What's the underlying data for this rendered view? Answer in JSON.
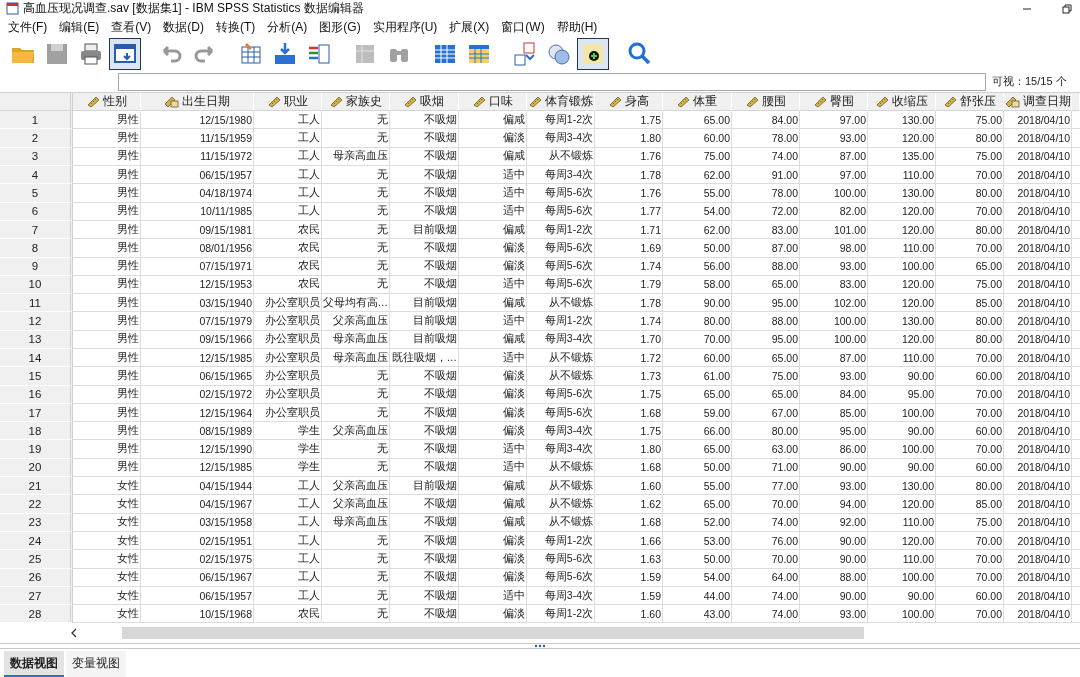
{
  "window": {
    "title": "高血压现况调查.sav [数据集1] - IBM SPSS Statistics 数据编辑器"
  },
  "menu": [
    "文件(F)",
    "编辑(E)",
    "查看(V)",
    "数据(D)",
    "转换(T)",
    "分析(A)",
    "图形(G)",
    "实用程序(U)",
    "扩展(X)",
    "窗口(W)",
    "帮助(H)"
  ],
  "toolbar": [
    {
      "disabled": false,
      "selected": false
    },
    {
      "disabled": true,
      "selected": false
    },
    {
      "disabled": false,
      "selected": false
    },
    {
      "disabled": false,
      "selected": true
    },
    {
      "disabled": true,
      "selected": false
    },
    {
      "disabled": true,
      "selected": false
    },
    {
      "disabled": false,
      "selected": false
    },
    {
      "disabled": false,
      "selected": false
    },
    {
      "disabled": false,
      "selected": false
    },
    {
      "disabled": true,
      "selected": false
    },
    {
      "disabled": true,
      "selected": false
    },
    {
      "disabled": false,
      "selected": false
    },
    {
      "disabled": false,
      "selected": false
    },
    {
      "disabled": false,
      "selected": false
    },
    {
      "disabled": false,
      "selected": false
    },
    {
      "disabled": false,
      "selected": true
    },
    {
      "disabled": false,
      "selected": false
    }
  ],
  "visible_count": "可视：15/15 个",
  "table": {
    "columns": [
      {
        "label": "性别",
        "kind": "scale"
      },
      {
        "label": "出生日期",
        "kind": "date"
      },
      {
        "label": "职业",
        "kind": "scale"
      },
      {
        "label": "家族史",
        "kind": "scale"
      },
      {
        "label": "吸烟",
        "kind": "scale"
      },
      {
        "label": "口味",
        "kind": "scale"
      },
      {
        "label": "体育锻炼",
        "kind": "scale"
      },
      {
        "label": "身高",
        "kind": "scale"
      },
      {
        "label": "体重",
        "kind": "scale"
      },
      {
        "label": "腰围",
        "kind": "scale"
      },
      {
        "label": "臀围",
        "kind": "scale"
      },
      {
        "label": "收缩压",
        "kind": "scale"
      },
      {
        "label": "舒张压",
        "kind": "scale"
      },
      {
        "label": "调查日期",
        "kind": "date"
      }
    ],
    "rows": [
      {
        "number": "1",
        "cells": [
          "男性",
          "12/15/1980",
          "工人",
          "无",
          "不吸烟",
          "偏咸",
          "每周1-2次",
          "1.75",
          "65.00",
          "84.00",
          "97.00",
          "130.00",
          "75.00",
          "2018/04/10"
        ]
      },
      {
        "number": "2",
        "cells": [
          "男性",
          "11/15/1959",
          "工人",
          "无",
          "不吸烟",
          "偏淡",
          "每周3-4次",
          "1.80",
          "60.00",
          "78.00",
          "93.00",
          "120.00",
          "80.00",
          "2018/04/10"
        ]
      },
      {
        "number": "3",
        "cells": [
          "男性",
          "11/15/1972",
          "工人",
          "母亲高血压",
          "不吸烟",
          "偏咸",
          "从不锻炼",
          "1.76",
          "75.00",
          "74.00",
          "87.00",
          "135.00",
          "75.00",
          "2018/04/10"
        ]
      },
      {
        "number": "4",
        "cells": [
          "男性",
          "06/15/1957",
          "工人",
          "无",
          "不吸烟",
          "适中",
          "每周3-4次",
          "1.78",
          "62.00",
          "91.00",
          "97.00",
          "110.00",
          "70.00",
          "2018/04/10"
        ]
      },
      {
        "number": "5",
        "cells": [
          "男性",
          "04/18/1974",
          "工人",
          "无",
          "不吸烟",
          "适中",
          "每周5-6次",
          "1.76",
          "55.00",
          "78.00",
          "100.00",
          "130.00",
          "80.00",
          "2018/04/10"
        ]
      },
      {
        "number": "6",
        "cells": [
          "男性",
          "10/11/1985",
          "工人",
          "无",
          "不吸烟",
          "适中",
          "每周5-6次",
          "1.77",
          "54.00",
          "72.00",
          "82.00",
          "120.00",
          "70.00",
          "2018/04/10"
        ]
      },
      {
        "number": "7",
        "cells": [
          "男性",
          "09/15/1981",
          "农民",
          "无",
          "目前吸烟",
          "偏咸",
          "每周1-2次",
          "1.71",
          "62.00",
          "83.00",
          "101.00",
          "120.00",
          "80.00",
          "2018/04/10"
        ]
      },
      {
        "number": "8",
        "cells": [
          "男性",
          "08/01/1956",
          "农民",
          "无",
          "不吸烟",
          "偏淡",
          "每周5-6次",
          "1.69",
          "50.00",
          "87.00",
          "98.00",
          "110.00",
          "70.00",
          "2018/04/10"
        ]
      },
      {
        "number": "9",
        "cells": [
          "男性",
          "07/15/1971",
          "农民",
          "无",
          "不吸烟",
          "偏淡",
          "每周5-6次",
          "1.74",
          "56.00",
          "88.00",
          "93.00",
          "100.00",
          "65.00",
          "2018/04/10"
        ]
      },
      {
        "number": "10",
        "cells": [
          "男性",
          "12/15/1953",
          "农民",
          "无",
          "不吸烟",
          "适中",
          "每周5-6次",
          "1.79",
          "58.00",
          "65.00",
          "83.00",
          "120.00",
          "75.00",
          "2018/04/10"
        ]
      },
      {
        "number": "11",
        "cells": [
          "男性",
          "03/15/1940",
          "办公室职员",
          "父母均有高…",
          "目前吸烟",
          "偏咸",
          "从不锻炼",
          "1.78",
          "90.00",
          "95.00",
          "102.00",
          "120.00",
          "85.00",
          "2018/04/10"
        ]
      },
      {
        "number": "12",
        "cells": [
          "男性",
          "07/15/1979",
          "办公室职员",
          "父亲高血压",
          "目前吸烟",
          "适中",
          "每周1-2次",
          "1.74",
          "80.00",
          "88.00",
          "100.00",
          "130.00",
          "80.00",
          "2018/04/10"
        ]
      },
      {
        "number": "13",
        "cells": [
          "男性",
          "09/15/1966",
          "办公室职员",
          "母亲高血压",
          "目前吸烟",
          "偏咸",
          "每周3-4次",
          "1.70",
          "70.00",
          "95.00",
          "100.00",
          "120.00",
          "80.00",
          "2018/04/10"
        ]
      },
      {
        "number": "14",
        "cells": [
          "男性",
          "12/15/1985",
          "办公室职员",
          "母亲高血压",
          "既往吸烟，…",
          "适中",
          "从不锻炼",
          "1.72",
          "60.00",
          "65.00",
          "87.00",
          "110.00",
          "70.00",
          "2018/04/10"
        ]
      },
      {
        "number": "15",
        "cells": [
          "男性",
          "06/15/1965",
          "办公室职员",
          "无",
          "不吸烟",
          "偏淡",
          "从不锻炼",
          "1.73",
          "61.00",
          "75.00",
          "93.00",
          "90.00",
          "60.00",
          "2018/04/10"
        ]
      },
      {
        "number": "16",
        "cells": [
          "男性",
          "02/15/1972",
          "办公室职员",
          "无",
          "不吸烟",
          "偏淡",
          "每周5-6次",
          "1.75",
          "65.00",
          "65.00",
          "84.00",
          "95.00",
          "70.00",
          "2018/04/10"
        ]
      },
      {
        "number": "17",
        "cells": [
          "男性",
          "12/15/1964",
          "办公室职员",
          "无",
          "不吸烟",
          "偏淡",
          "每周5-6次",
          "1.68",
          "59.00",
          "67.00",
          "85.00",
          "100.00",
          "70.00",
          "2018/04/10"
        ]
      },
      {
        "number": "18",
        "cells": [
          "男性",
          "08/15/1989",
          "学生",
          "父亲高血压",
          "不吸烟",
          "偏淡",
          "每周3-4次",
          "1.75",
          "66.00",
          "80.00",
          "95.00",
          "90.00",
          "60.00",
          "2018/04/10"
        ]
      },
      {
        "number": "19",
        "cells": [
          "男性",
          "12/15/1990",
          "学生",
          "无",
          "不吸烟",
          "适中",
          "每周3-4次",
          "1.80",
          "65.00",
          "63.00",
          "86.00",
          "100.00",
          "70.00",
          "2018/04/10"
        ]
      },
      {
        "number": "20",
        "cells": [
          "男性",
          "12/15/1985",
          "学生",
          "无",
          "不吸烟",
          "适中",
          "从不锻炼",
          "1.68",
          "50.00",
          "71.00",
          "90.00",
          "90.00",
          "60.00",
          "2018/04/10"
        ]
      },
      {
        "number": "21",
        "cells": [
          "女性",
          "04/15/1944",
          "工人",
          "父亲高血压",
          "目前吸烟",
          "偏咸",
          "从不锻炼",
          "1.60",
          "55.00",
          "77.00",
          "93.00",
          "130.00",
          "80.00",
          "2018/04/10"
        ]
      },
      {
        "number": "22",
        "cells": [
          "女性",
          "04/15/1967",
          "工人",
          "父亲高血压",
          "不吸烟",
          "偏咸",
          "从不锻炼",
          "1.62",
          "65.00",
          "70.00",
          "94.00",
          "120.00",
          "85.00",
          "2018/04/10"
        ]
      },
      {
        "number": "23",
        "cells": [
          "女性",
          "03/15/1958",
          "工人",
          "母亲高血压",
          "不吸烟",
          "偏咸",
          "从不锻炼",
          "1.68",
          "52.00",
          "74.00",
          "92.00",
          "110.00",
          "75.00",
          "2018/04/10"
        ]
      },
      {
        "number": "24",
        "cells": [
          "女性",
          "02/15/1951",
          "工人",
          "无",
          "不吸烟",
          "偏淡",
          "每周1-2次",
          "1.66",
          "53.00",
          "76.00",
          "90.00",
          "120.00",
          "70.00",
          "2018/04/10"
        ]
      },
      {
        "number": "25",
        "cells": [
          "女性",
          "02/15/1975",
          "工人",
          "无",
          "不吸烟",
          "偏淡",
          "每周5-6次",
          "1.63",
          "50.00",
          "70.00",
          "90.00",
          "110.00",
          "70.00",
          "2018/04/10"
        ]
      },
      {
        "number": "26",
        "cells": [
          "女性",
          "06/15/1967",
          "工人",
          "无",
          "不吸烟",
          "偏淡",
          "每周5-6次",
          "1.59",
          "54.00",
          "64.00",
          "88.00",
          "100.00",
          "70.00",
          "2018/04/10"
        ]
      },
      {
        "number": "27",
        "cells": [
          "女性",
          "06/15/1957",
          "工人",
          "无",
          "不吸烟",
          "适中",
          "每周3-4次",
          "1.59",
          "44.00",
          "74.00",
          "90.00",
          "90.00",
          "60.00",
          "2018/04/10"
        ]
      },
      {
        "number": "28",
        "cells": [
          "女性",
          "10/15/1968",
          "农民",
          "无",
          "不吸烟",
          "偏淡",
          "每周1-2次",
          "1.60",
          "43.00",
          "74.00",
          "93.00",
          "100.00",
          "70.00",
          "2018/04/10"
        ]
      }
    ]
  },
  "view_tabs": [
    {
      "label": "数据视图",
      "selected": true
    },
    {
      "label": "变量视图",
      "selected": false
    }
  ]
}
